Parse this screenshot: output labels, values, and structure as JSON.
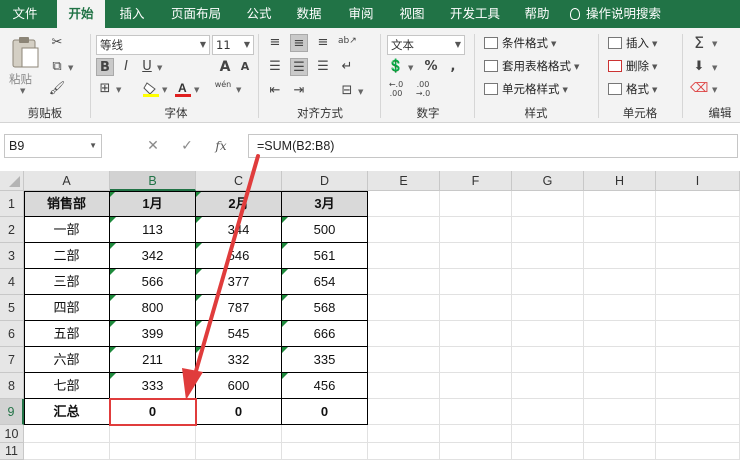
{
  "tabs": [
    "文件",
    "开始",
    "插入",
    "页面布局",
    "公式",
    "数据",
    "审阅",
    "视图",
    "开发工具",
    "帮助",
    "操作说明搜索"
  ],
  "active_tab": "开始",
  "ribbon": {
    "clipboard": {
      "paste": "粘贴",
      "group": "剪贴板"
    },
    "font": {
      "name": "等线",
      "size": "11",
      "bold": "B",
      "italic": "I",
      "underline": "U",
      "grow": "A",
      "shrink": "A",
      "phonetic": "wén",
      "group": "字体"
    },
    "alignment": {
      "group": "对齐方式"
    },
    "number": {
      "format": "文本",
      "group": "数字"
    },
    "styles": {
      "cond": "条件格式",
      "table": "套用表格格式",
      "cell": "单元格样式",
      "group": "样式"
    },
    "cells": {
      "insert": "插入",
      "delete": "删除",
      "format": "格式",
      "group": "单元格"
    },
    "editing": {
      "group": "编辑"
    }
  },
  "formula_bar": {
    "name_box": "B9",
    "formula": "=SUM(B2:B8)"
  },
  "sheet": {
    "columns": [
      "A",
      "B",
      "C",
      "D",
      "E",
      "F",
      "G",
      "H",
      "I"
    ],
    "rows": [
      "1",
      "2",
      "3",
      "4",
      "5",
      "6",
      "7",
      "8",
      "9",
      "10",
      "11"
    ],
    "table": [
      [
        "销售部",
        "1月",
        "2月",
        "3月"
      ],
      [
        "一部",
        "113",
        "344",
        "500"
      ],
      [
        "二部",
        "342",
        "546",
        "561"
      ],
      [
        "三部",
        "566",
        "377",
        "654"
      ],
      [
        "四部",
        "800",
        "787",
        "568"
      ],
      [
        "五部",
        "399",
        "545",
        "666"
      ],
      [
        "六部",
        "211",
        "332",
        "335"
      ],
      [
        "七部",
        "333",
        "600",
        "456"
      ],
      [
        "汇总",
        "0",
        "0",
        "0"
      ]
    ],
    "selected_cell": "B9",
    "annotation_color": "#e03c3c"
  }
}
